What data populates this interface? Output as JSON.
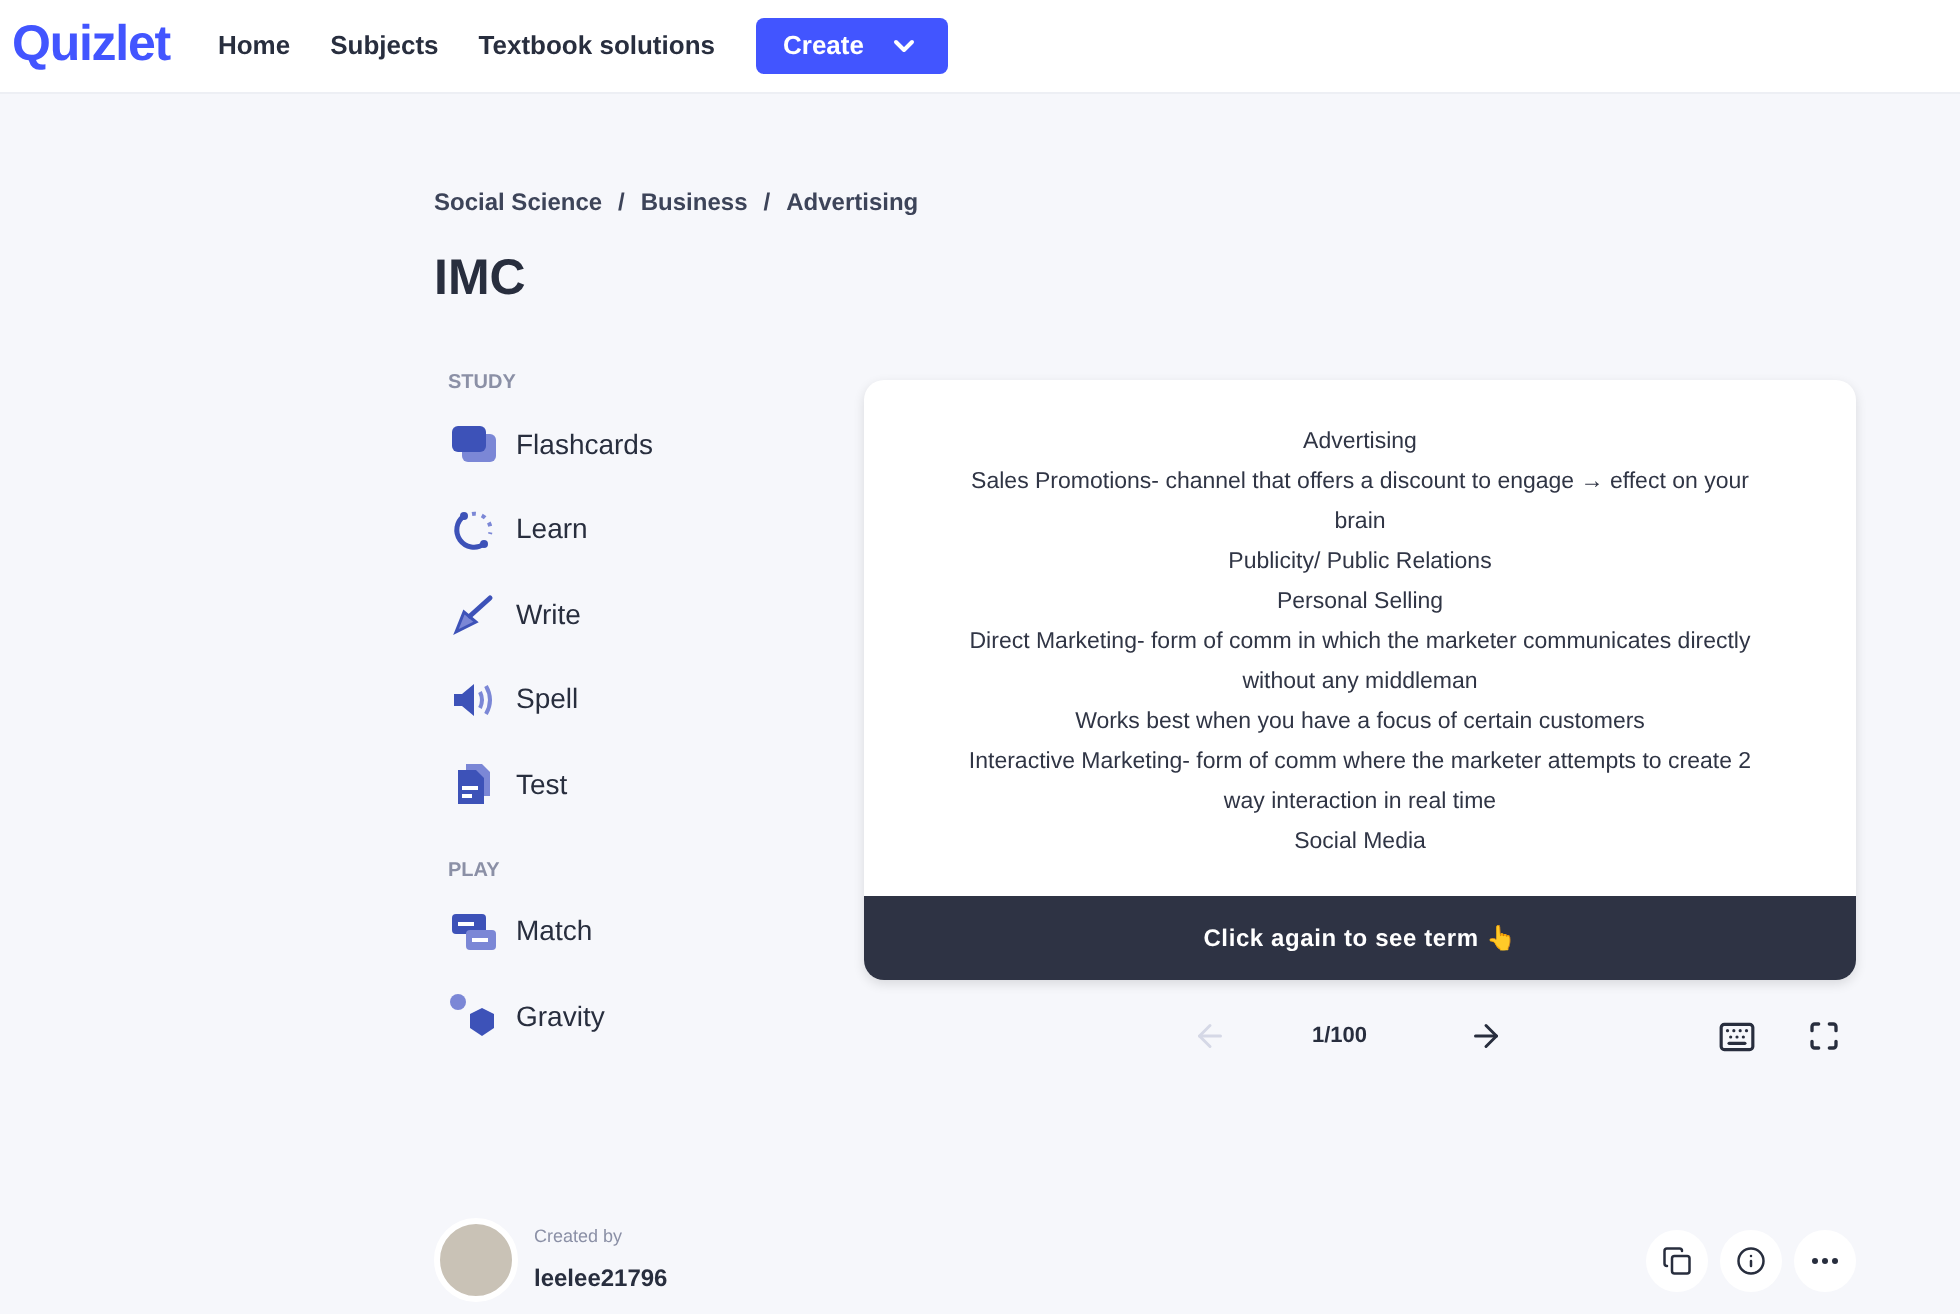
{
  "header": {
    "logo": "Quizlet",
    "nav": [
      "Home",
      "Subjects",
      "Textbook solutions"
    ],
    "create_button": "Create"
  },
  "breadcrumbs": [
    "Social Science",
    "Business",
    "Advertising"
  ],
  "breadcrumb_separator": "/",
  "title": "IMC",
  "modes": [
    {
      "heading": "STUDY",
      "items": [
        {
          "label": "Flashcards",
          "kind": "flashcards"
        },
        {
          "label": "Learn",
          "kind": "learn"
        },
        {
          "label": "Write",
          "kind": "write"
        },
        {
          "label": "Spell",
          "kind": "spell"
        },
        {
          "label": "Test",
          "kind": "test"
        }
      ]
    },
    {
      "heading": "PLAY",
      "items": [
        {
          "label": "Match",
          "kind": "match"
        },
        {
          "label": "Gravity",
          "kind": "gravity"
        }
      ]
    }
  ],
  "card": {
    "lines": [
      "Advertising",
      "Sales Promotions- channel that offers a discount to engage → effect on your brain",
      "Publicity/ Public Relations",
      "Personal Selling",
      "Direct Marketing- form of comm in which the marketer communicates directly without any middleman",
      "Works best when you have a focus of certain customers",
      "Interactive Marketing- form of comm where the marketer attempts to create 2 way interaction in real time",
      "Social Media"
    ],
    "footer": "Click again to see term 👆"
  },
  "pager": {
    "prev_disabled": true,
    "next_disabled": false,
    "counter": "1/100"
  },
  "creator": {
    "caption": "Created by",
    "username": "leelee21796"
  }
}
